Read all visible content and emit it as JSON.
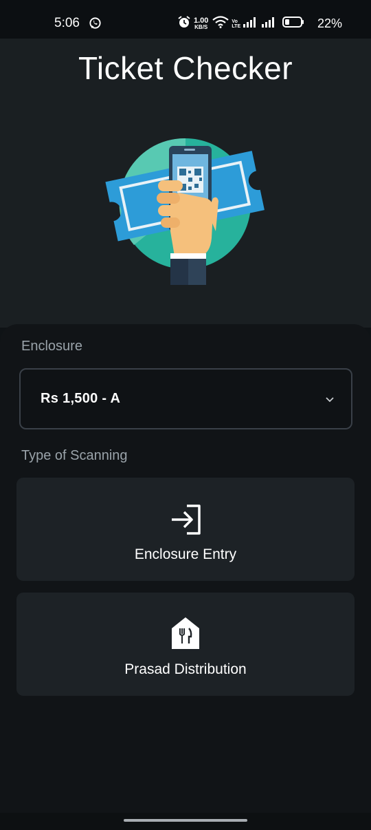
{
  "status_bar": {
    "time": "5:06",
    "net_speed_value": "1.00",
    "net_speed_unit": "KB/S",
    "volte_top": "Vo",
    "volte_bottom": "LTE",
    "battery": "22%"
  },
  "header": {
    "title": "Ticket Checker"
  },
  "form": {
    "enclosure_label": "Enclosure",
    "enclosure_value": "Rs 1,500 - A",
    "scanning_label": "Type of Scanning"
  },
  "options": [
    {
      "label": "Enclosure Entry",
      "icon": "login-icon"
    },
    {
      "label": "Prasad Distribution",
      "icon": "food-house-icon"
    }
  ],
  "colors": {
    "background": "#0f1316",
    "header_background": "#1a1f22",
    "card": "#1d2226",
    "illustration_circle": "#27b29c",
    "ticket": "#2d9cd8"
  }
}
